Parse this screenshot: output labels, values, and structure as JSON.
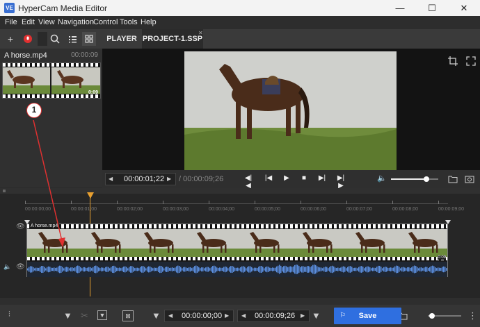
{
  "window": {
    "title": "HyperCam Media Editor",
    "logo_text": "VE",
    "minimize": "—",
    "maximize": "☐",
    "close": "✕"
  },
  "menu": [
    "File",
    "Edit",
    "View",
    "Navigation",
    "Control",
    "Tools",
    "Help"
  ],
  "tabs": [
    {
      "label": "PLAYER",
      "active": false
    },
    {
      "label": "PROJECT-1.SSP",
      "active": true
    }
  ],
  "media": {
    "clip_name": "A horse.mp4",
    "clip_duration": "00:00:09",
    "thumb_duration": "0:09"
  },
  "player": {
    "current_time": "00:00:01;22",
    "total_time": "/ 00:00:09;26",
    "volume_fraction": 0.75
  },
  "timeline": {
    "ruler_labels": [
      "00:00:00;00",
      "00:00:01;00",
      "00:00:02;00",
      "00:00:03;00",
      "00:00:04;00",
      "00:00:05;00",
      "00:00:06;00",
      "00:00:07;00",
      "00:00:08;00",
      "00:00:09;00"
    ],
    "track_clip_label": "A horse.mp4",
    "track_clip_duration": "0:09",
    "annotation_number": "1"
  },
  "bottom": {
    "mark_in": "00:00:00;00",
    "mark_out": "00:00:09;26",
    "save_label": "Save"
  },
  "colors": {
    "accent": "#2f6fe0",
    "playhead": "#e8a030",
    "waveform": "#5b8fe0",
    "annotation": "#e03030"
  }
}
